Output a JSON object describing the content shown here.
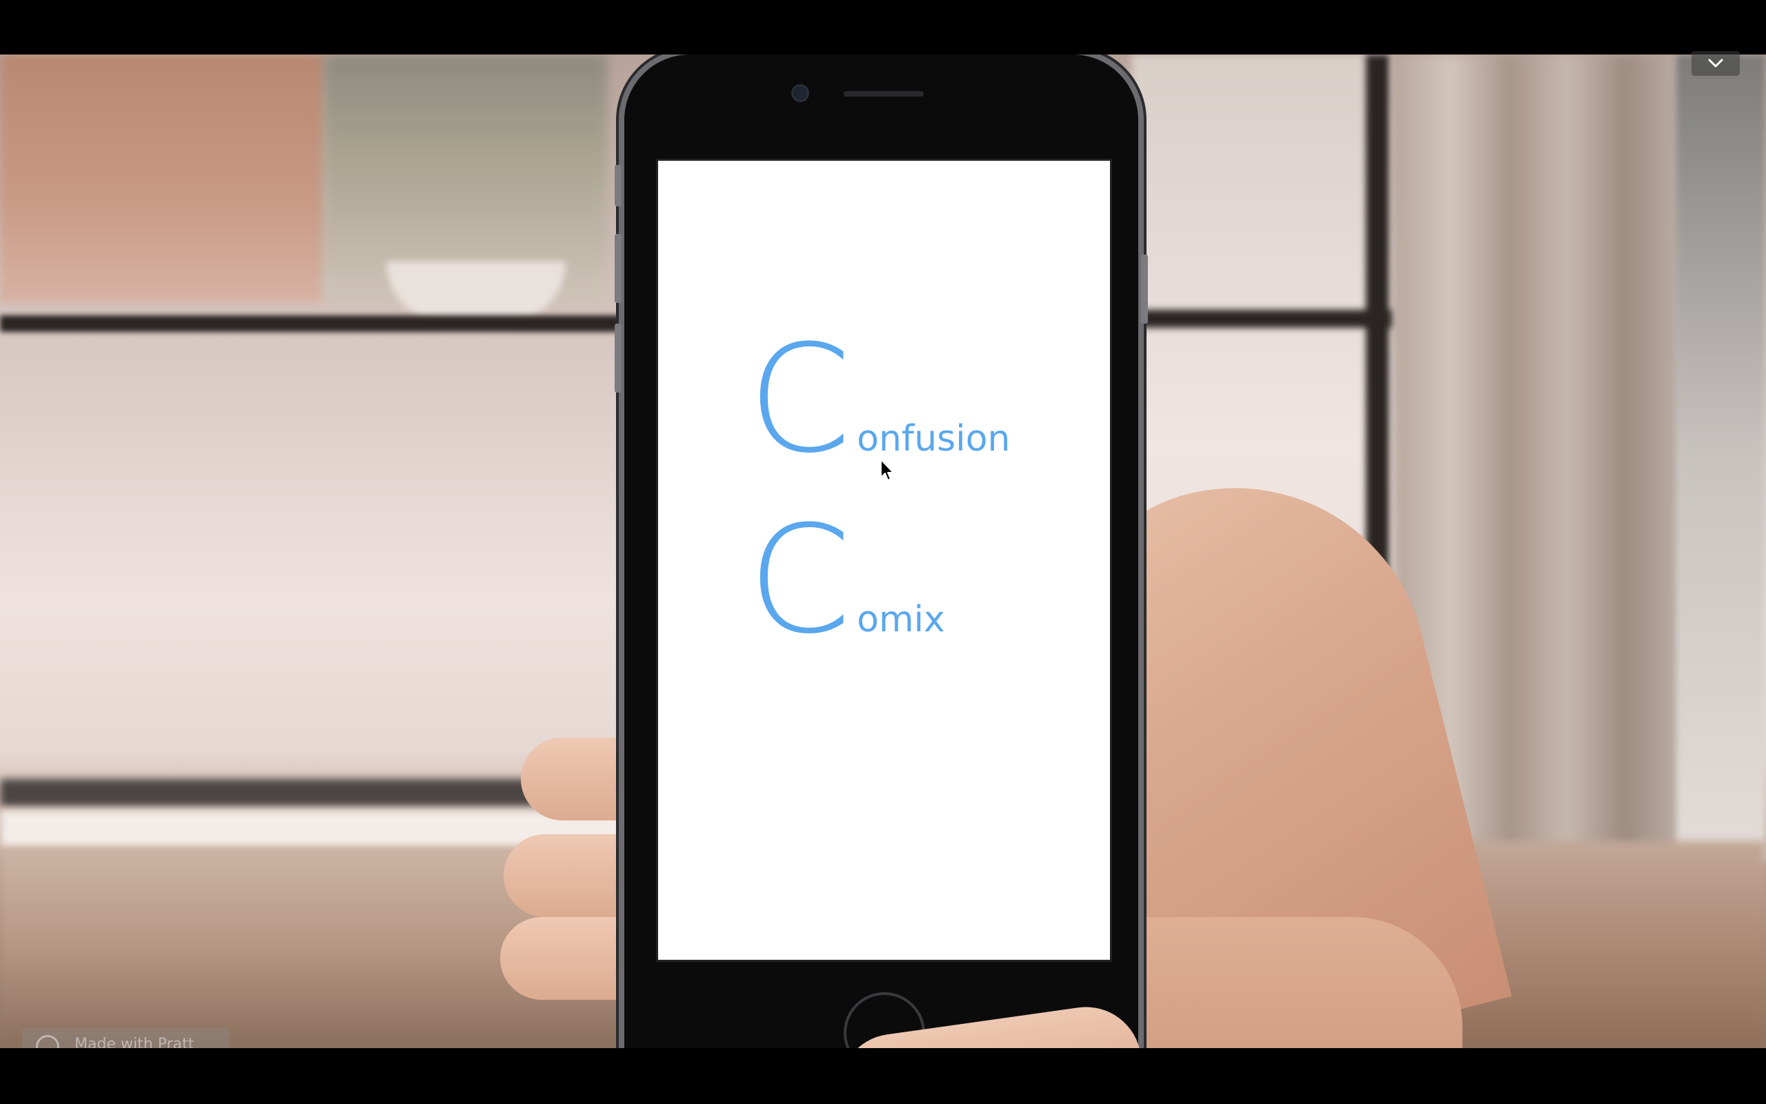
{
  "video_frame": {
    "background_scene": "blurred-room-with-windows",
    "device": "smartphone-held-in-hand"
  },
  "app_screen": {
    "lines": [
      {
        "initial": "C",
        "rest": "onfusion"
      },
      {
        "initial": "C",
        "rest": "omix"
      }
    ],
    "accent_color": "#5aa7ee",
    "background_color": "#ffffff"
  },
  "controls": {
    "collapse_icon": "chevron-down-icon"
  },
  "badge": {
    "label": "Made with Pratt"
  }
}
